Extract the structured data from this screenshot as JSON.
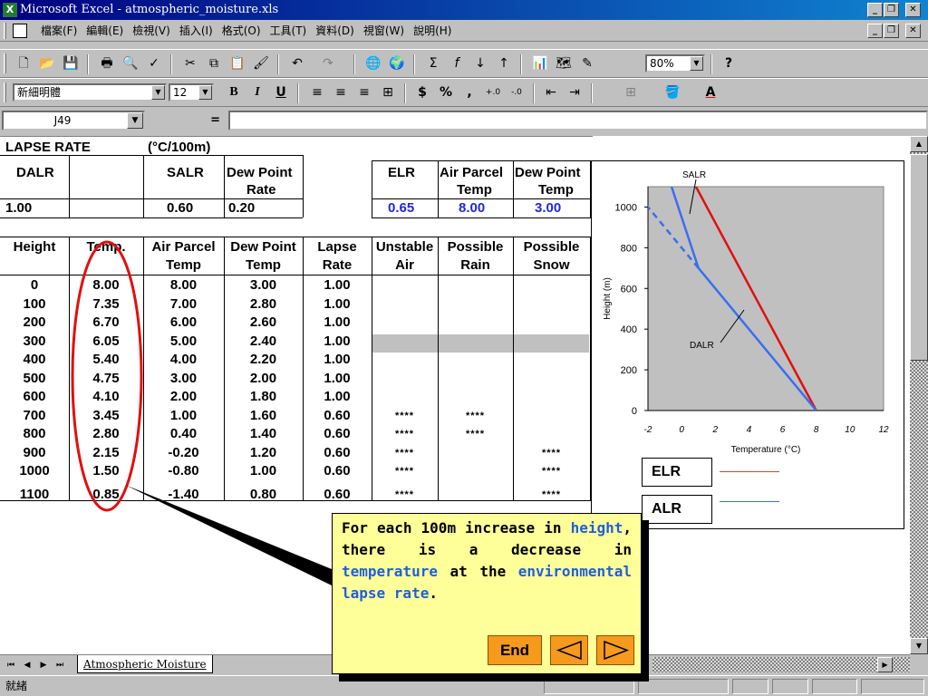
{
  "window": {
    "title": "Microsoft Excel - atmospheric_moisture.xls"
  },
  "menu": [
    "檔案(F)",
    "編輯(E)",
    "檢視(V)",
    "插入(I)",
    "格式(O)",
    "工具(T)",
    "資料(D)",
    "視窗(W)",
    "說明(H)"
  ],
  "toolbar": {
    "zoom": "80%",
    "font": "新細明體",
    "font_size": "12"
  },
  "formula": {
    "cell_ref": "J49",
    "equals": "="
  },
  "sheet": {
    "lapse_label": "LAPSE RATE",
    "lapse_unit": "(°C/100m)",
    "hdr1": {
      "dalr": "DALR",
      "salr": "SALR",
      "dew_rate_1": "Dew Point",
      "dew_rate_2": "Rate",
      "elr": "ELR",
      "ap_1": "Air Parcel",
      "ap_2": "Temp",
      "dp_1": "Dew Point",
      "dp_2": "Temp"
    },
    "vals1": {
      "dalr": "1.00",
      "salr": "0.60",
      "dew_rate": "0.20",
      "elr": "0.65",
      "air_parcel": "8.00",
      "dew_point": "3.00"
    },
    "columns": [
      {
        "l1": "Height",
        "l2": ""
      },
      {
        "l1": "Temp.",
        "l2": ""
      },
      {
        "l1": "Air Parcel",
        "l2": "Temp"
      },
      {
        "l1": "Dew Point",
        "l2": "Temp"
      },
      {
        "l1": "Lapse",
        "l2": "Rate"
      },
      {
        "l1": "Unstable",
        "l2": "Air"
      },
      {
        "l1": "Possible",
        "l2": "Rain"
      },
      {
        "l1": "Possible",
        "l2": "Snow"
      }
    ],
    "rows": [
      [
        "0",
        "8.00",
        "8.00",
        "3.00",
        "1.00",
        "",
        "",
        ""
      ],
      [
        "100",
        "7.35",
        "7.00",
        "2.80",
        "1.00",
        "",
        "",
        ""
      ],
      [
        "200",
        "6.70",
        "6.00",
        "2.60",
        "1.00",
        "",
        "",
        ""
      ],
      [
        "300",
        "6.05",
        "5.00",
        "2.40",
        "1.00",
        "",
        "",
        ""
      ],
      [
        "400",
        "5.40",
        "4.00",
        "2.20",
        "1.00",
        "",
        "",
        ""
      ],
      [
        "500",
        "4.75",
        "3.00",
        "2.00",
        "1.00",
        "",
        "",
        ""
      ],
      [
        "600",
        "4.10",
        "2.00",
        "1.80",
        "1.00",
        "",
        "",
        ""
      ],
      [
        "700",
        "3.45",
        "1.00",
        "1.60",
        "0.60",
        "****",
        "****",
        ""
      ],
      [
        "800",
        "2.80",
        "0.40",
        "1.40",
        "0.60",
        "****",
        "****",
        ""
      ],
      [
        "900",
        "2.15",
        "-0.20",
        "1.20",
        "0.60",
        "****",
        "",
        "****"
      ],
      [
        "1000",
        "1.50",
        "-0.80",
        "1.00",
        "0.60",
        "****",
        "",
        "****"
      ],
      [
        "1100",
        "0.85",
        "-1.40",
        "0.80",
        "0.60",
        "****",
        "",
        "****"
      ]
    ]
  },
  "chart_data": {
    "type": "line",
    "xlabel": "Temperature (°C)",
    "ylabel": "Height (m)",
    "xlim": [
      -2,
      12
    ],
    "ylim": [
      0,
      1100
    ],
    "xticks": [
      "-2",
      "0",
      "2",
      "4",
      "6",
      "8",
      "10",
      "12"
    ],
    "yticks": [
      "0",
      "200",
      "400",
      "600",
      "800",
      "1000"
    ],
    "series": [
      {
        "name": "ELR",
        "color": "#e01010",
        "style": "solid",
        "points": [
          [
            8.0,
            0
          ],
          [
            0.85,
            1100
          ]
        ]
      },
      {
        "name": "ALR",
        "color": "#3a6ef0",
        "style": "solid",
        "points": [
          [
            8.0,
            0
          ],
          [
            1.0,
            700
          ],
          [
            -0.6,
            1100
          ]
        ]
      },
      {
        "name": "",
        "color": "#3a6ef0",
        "style": "dashed",
        "points": [
          [
            1.0,
            700
          ],
          [
            -3.0,
            1100
          ]
        ]
      }
    ],
    "annotations": [
      "SALR",
      "DALR"
    ]
  },
  "legend": [
    {
      "name": "ELR",
      "color": "#c0502c"
    },
    {
      "name": "ALR",
      "color": "#3a6ef0"
    }
  ],
  "tabs": {
    "sheet_name": "Atmospheric Moisture"
  },
  "status": {
    "text": "就緒"
  },
  "callout": {
    "t1": "For each 100m increase in ",
    "k1": "height",
    "t2": ", there is a decrease in ",
    "k2": "temperature",
    "t3": " at the ",
    "k3": "environmental lapse rate",
    "t4": ".",
    "end_label": "End"
  },
  "colors": {
    "accent_blue": "#1f28d8",
    "callout_bg": "#ffff99",
    "button": "#f59a1c"
  }
}
